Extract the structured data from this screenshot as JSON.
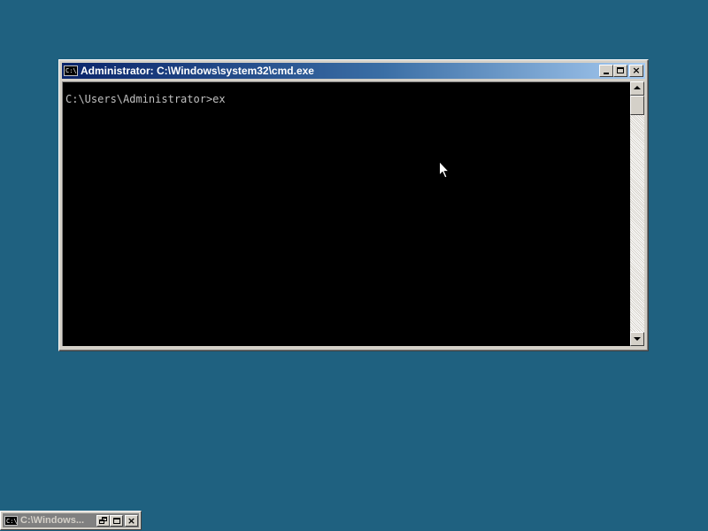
{
  "desktop": {
    "background_color": "#1f6180"
  },
  "window": {
    "icon_text": "C:\\",
    "title": "Administrator: C:\\Windows\\system32\\cmd.exe",
    "buttons": {
      "minimize": "minimize-icon",
      "maximize": "maximize-icon",
      "close": "×"
    },
    "console": {
      "line": "C:\\Users\\Administrator>ex",
      "text_color": "#c0c0c0",
      "background_color": "#000000"
    }
  },
  "minimized_window": {
    "icon_text": "C:\\",
    "title": "C:\\Windows...",
    "buttons": {
      "restore": "restore-icon",
      "maximize": "maximize-icon",
      "close": "×"
    }
  }
}
